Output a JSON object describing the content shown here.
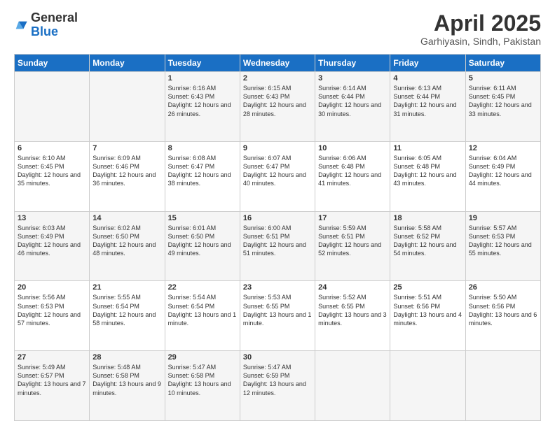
{
  "logo": {
    "text_general": "General",
    "text_blue": "Blue"
  },
  "title": "April 2025",
  "subtitle": "Garhiyasin, Sindh, Pakistan",
  "days_of_week": [
    "Sunday",
    "Monday",
    "Tuesday",
    "Wednesday",
    "Thursday",
    "Friday",
    "Saturday"
  ],
  "weeks": [
    [
      {
        "day": "",
        "sunrise": "",
        "sunset": "",
        "daylight": ""
      },
      {
        "day": "",
        "sunrise": "",
        "sunset": "",
        "daylight": ""
      },
      {
        "day": "1",
        "sunrise": "Sunrise: 6:16 AM",
        "sunset": "Sunset: 6:43 PM",
        "daylight": "Daylight: 12 hours and 26 minutes."
      },
      {
        "day": "2",
        "sunrise": "Sunrise: 6:15 AM",
        "sunset": "Sunset: 6:43 PM",
        "daylight": "Daylight: 12 hours and 28 minutes."
      },
      {
        "day": "3",
        "sunrise": "Sunrise: 6:14 AM",
        "sunset": "Sunset: 6:44 PM",
        "daylight": "Daylight: 12 hours and 30 minutes."
      },
      {
        "day": "4",
        "sunrise": "Sunrise: 6:13 AM",
        "sunset": "Sunset: 6:44 PM",
        "daylight": "Daylight: 12 hours and 31 minutes."
      },
      {
        "day": "5",
        "sunrise": "Sunrise: 6:11 AM",
        "sunset": "Sunset: 6:45 PM",
        "daylight": "Daylight: 12 hours and 33 minutes."
      }
    ],
    [
      {
        "day": "6",
        "sunrise": "Sunrise: 6:10 AM",
        "sunset": "Sunset: 6:45 PM",
        "daylight": "Daylight: 12 hours and 35 minutes."
      },
      {
        "day": "7",
        "sunrise": "Sunrise: 6:09 AM",
        "sunset": "Sunset: 6:46 PM",
        "daylight": "Daylight: 12 hours and 36 minutes."
      },
      {
        "day": "8",
        "sunrise": "Sunrise: 6:08 AM",
        "sunset": "Sunset: 6:47 PM",
        "daylight": "Daylight: 12 hours and 38 minutes."
      },
      {
        "day": "9",
        "sunrise": "Sunrise: 6:07 AM",
        "sunset": "Sunset: 6:47 PM",
        "daylight": "Daylight: 12 hours and 40 minutes."
      },
      {
        "day": "10",
        "sunrise": "Sunrise: 6:06 AM",
        "sunset": "Sunset: 6:48 PM",
        "daylight": "Daylight: 12 hours and 41 minutes."
      },
      {
        "day": "11",
        "sunrise": "Sunrise: 6:05 AM",
        "sunset": "Sunset: 6:48 PM",
        "daylight": "Daylight: 12 hours and 43 minutes."
      },
      {
        "day": "12",
        "sunrise": "Sunrise: 6:04 AM",
        "sunset": "Sunset: 6:49 PM",
        "daylight": "Daylight: 12 hours and 44 minutes."
      }
    ],
    [
      {
        "day": "13",
        "sunrise": "Sunrise: 6:03 AM",
        "sunset": "Sunset: 6:49 PM",
        "daylight": "Daylight: 12 hours and 46 minutes."
      },
      {
        "day": "14",
        "sunrise": "Sunrise: 6:02 AM",
        "sunset": "Sunset: 6:50 PM",
        "daylight": "Daylight: 12 hours and 48 minutes."
      },
      {
        "day": "15",
        "sunrise": "Sunrise: 6:01 AM",
        "sunset": "Sunset: 6:50 PM",
        "daylight": "Daylight: 12 hours and 49 minutes."
      },
      {
        "day": "16",
        "sunrise": "Sunrise: 6:00 AM",
        "sunset": "Sunset: 6:51 PM",
        "daylight": "Daylight: 12 hours and 51 minutes."
      },
      {
        "day": "17",
        "sunrise": "Sunrise: 5:59 AM",
        "sunset": "Sunset: 6:51 PM",
        "daylight": "Daylight: 12 hours and 52 minutes."
      },
      {
        "day": "18",
        "sunrise": "Sunrise: 5:58 AM",
        "sunset": "Sunset: 6:52 PM",
        "daylight": "Daylight: 12 hours and 54 minutes."
      },
      {
        "day": "19",
        "sunrise": "Sunrise: 5:57 AM",
        "sunset": "Sunset: 6:53 PM",
        "daylight": "Daylight: 12 hours and 55 minutes."
      }
    ],
    [
      {
        "day": "20",
        "sunrise": "Sunrise: 5:56 AM",
        "sunset": "Sunset: 6:53 PM",
        "daylight": "Daylight: 12 hours and 57 minutes."
      },
      {
        "day": "21",
        "sunrise": "Sunrise: 5:55 AM",
        "sunset": "Sunset: 6:54 PM",
        "daylight": "Daylight: 12 hours and 58 minutes."
      },
      {
        "day": "22",
        "sunrise": "Sunrise: 5:54 AM",
        "sunset": "Sunset: 6:54 PM",
        "daylight": "Daylight: 13 hours and 1 minute."
      },
      {
        "day": "23",
        "sunrise": "Sunrise: 5:53 AM",
        "sunset": "Sunset: 6:55 PM",
        "daylight": "Daylight: 13 hours and 1 minute."
      },
      {
        "day": "24",
        "sunrise": "Sunrise: 5:52 AM",
        "sunset": "Sunset: 6:55 PM",
        "daylight": "Daylight: 13 hours and 3 minutes."
      },
      {
        "day": "25",
        "sunrise": "Sunrise: 5:51 AM",
        "sunset": "Sunset: 6:56 PM",
        "daylight": "Daylight: 13 hours and 4 minutes."
      },
      {
        "day": "26",
        "sunrise": "Sunrise: 5:50 AM",
        "sunset": "Sunset: 6:56 PM",
        "daylight": "Daylight: 13 hours and 6 minutes."
      }
    ],
    [
      {
        "day": "27",
        "sunrise": "Sunrise: 5:49 AM",
        "sunset": "Sunset: 6:57 PM",
        "daylight": "Daylight: 13 hours and 7 minutes."
      },
      {
        "day": "28",
        "sunrise": "Sunrise: 5:48 AM",
        "sunset": "Sunset: 6:58 PM",
        "daylight": "Daylight: 13 hours and 9 minutes."
      },
      {
        "day": "29",
        "sunrise": "Sunrise: 5:47 AM",
        "sunset": "Sunset: 6:58 PM",
        "daylight": "Daylight: 13 hours and 10 minutes."
      },
      {
        "day": "30",
        "sunrise": "Sunrise: 5:47 AM",
        "sunset": "Sunset: 6:59 PM",
        "daylight": "Daylight: 13 hours and 12 minutes."
      },
      {
        "day": "",
        "sunrise": "",
        "sunset": "",
        "daylight": ""
      },
      {
        "day": "",
        "sunrise": "",
        "sunset": "",
        "daylight": ""
      },
      {
        "day": "",
        "sunrise": "",
        "sunset": "",
        "daylight": ""
      }
    ]
  ]
}
